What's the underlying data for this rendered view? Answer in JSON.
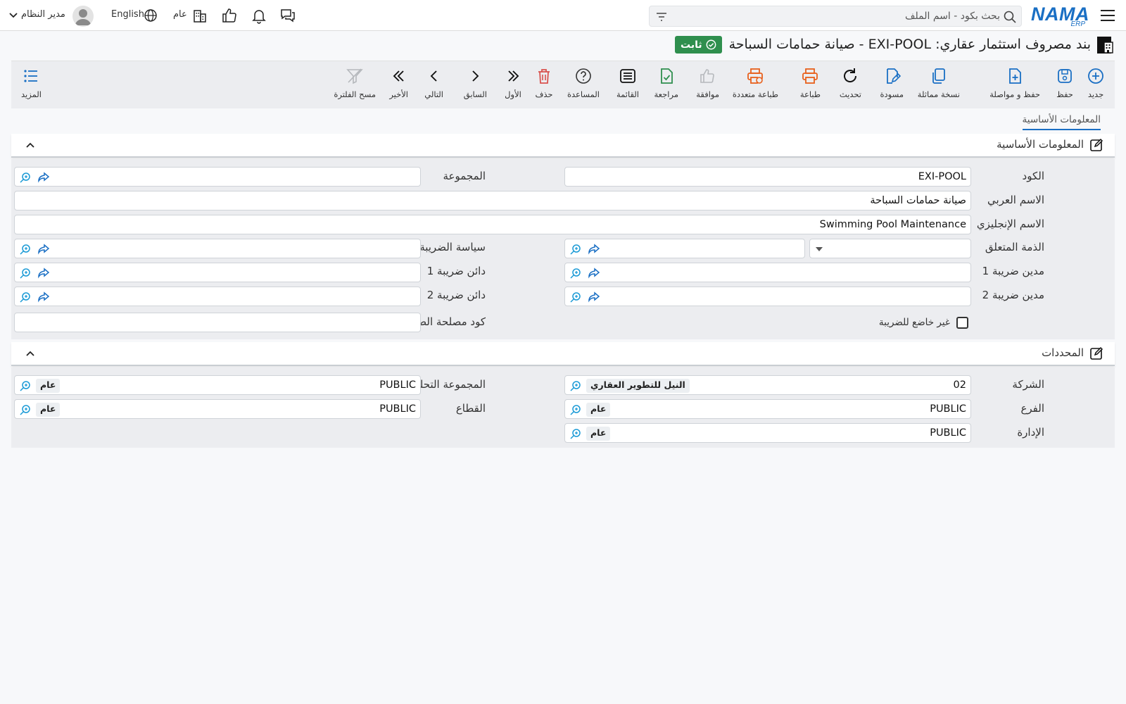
{
  "topbar": {
    "logo_text": "NAMA",
    "logo_sub": "ERP",
    "search_placeholder": "بحث بكود - اسم الملف",
    "company_label": "عام",
    "language_label": "English",
    "user_name": "مدير النظام"
  },
  "page": {
    "title": "بند مصروف استثمار عقاري: EXI-POOL - صيانة حمامات السباحة",
    "status": "ثابت",
    "status_color": "#2f8f4e"
  },
  "toolbar": {
    "new": "جديد",
    "save": "حفظ",
    "save_continue": "حفظ و مواصلة",
    "copy": "نسخة مماثلة",
    "draft": "مسودة",
    "refresh": "تحديث",
    "print": "طباعة",
    "multi_print": "طباعة متعددة",
    "approve": "موافقة",
    "review": "مراجعة",
    "list": "القائمة",
    "help": "المساعدة",
    "delete": "حذف",
    "first": "الأول",
    "previous": "السابق",
    "next": "التالي",
    "last": "الأخير",
    "clear_filter": "مسح الفلترة",
    "more": "المزيد"
  },
  "tabs": {
    "basic_info": "المعلومات الأساسية"
  },
  "basic": {
    "header": "المعلومات الأساسية",
    "code_label": "الكود",
    "code_value": "EXI-POOL",
    "group_label": "المجموعة",
    "group_value": "",
    "arabic_name_label": "الاسم العربي",
    "arabic_name_value": "صيانة حمامات السباحة",
    "english_name_label": "الاسم الإنجليزي",
    "english_name_value": "Swimming Pool Maintenance",
    "related_account_label": "الذمة المتعلق",
    "tax_policy_label": "سياسة الضريبة",
    "tax_debit1_label": "مدين ضريبة 1",
    "tax_credit1_label": "دائن ضريبة 1",
    "tax_debit2_label": "مدين ضريبة 2",
    "tax_credit2_label": "دائن ضريبة 2",
    "non_taxable_label": "غير خاضع للضريبة",
    "tax_authority_code_label": "كود مصلحة الضرائب"
  },
  "dimensions": {
    "header": "المحددات",
    "company_label": "الشركة",
    "company_code": "02",
    "company_name": "النيل للتطوير العقاري",
    "analytic_group_label": "المجموعة التحليلية",
    "analytic_group_code": "PUBLIC",
    "analytic_group_name": "عام",
    "branch_label": "الفرع",
    "branch_code": "PUBLIC",
    "branch_name": "عام",
    "sector_label": "القطاع",
    "sector_code": "PUBLIC",
    "sector_name": "عام",
    "department_label": "الإدارة",
    "department_code": "PUBLIC",
    "department_name": "عام"
  },
  "colors": {
    "accent": "#1a6fc4",
    "danger": "#d9534f",
    "print_orange": "#e8601c",
    "success": "#2f8f4e"
  }
}
